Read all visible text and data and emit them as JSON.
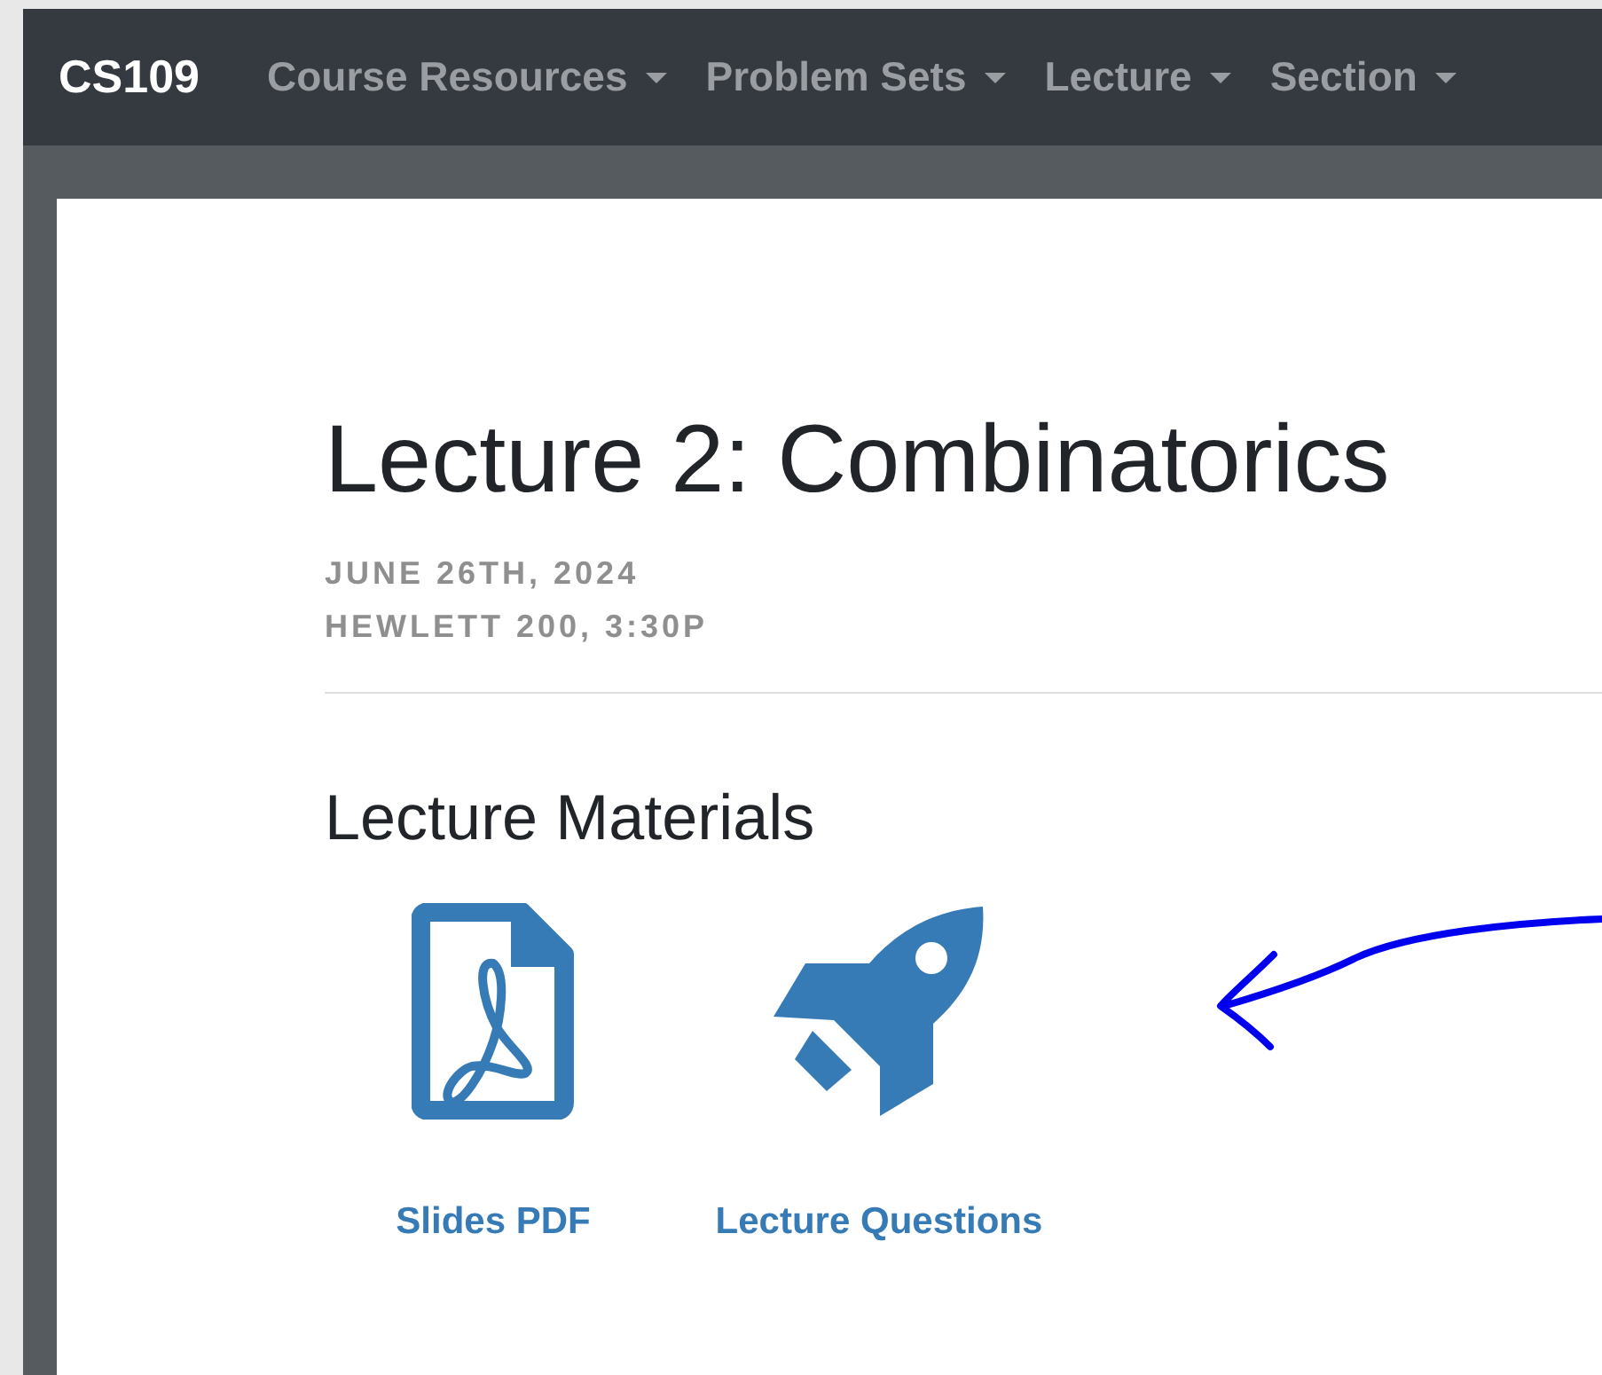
{
  "navbar": {
    "brand": "CS109",
    "menus": [
      {
        "label": "Course Resources"
      },
      {
        "label": "Problem Sets"
      },
      {
        "label": "Lecture"
      },
      {
        "label": "Section"
      }
    ]
  },
  "page": {
    "title": "Lecture 2: Combinatorics",
    "meta": [
      "JUNE 26TH, 2024",
      "HEWLETT 200, 3:30P"
    ],
    "materials_heading": "Lecture Materials",
    "materials": [
      {
        "kind": "pdf",
        "label": "Slides PDF"
      },
      {
        "kind": "rocket",
        "label": "Lecture Questions"
      }
    ]
  }
}
